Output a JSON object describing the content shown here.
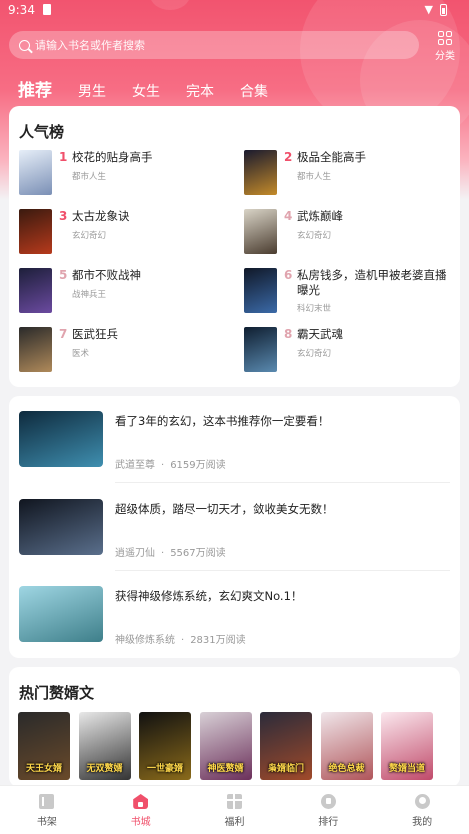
{
  "status": {
    "time": "9:34"
  },
  "search": {
    "placeholder": "请输入书名或作者搜索"
  },
  "category": {
    "label": "分类"
  },
  "tabs": [
    "推荐",
    "男生",
    "女生",
    "完本",
    "合集"
  ],
  "ranking": {
    "title": "人气榜",
    "items": [
      {
        "num": "1",
        "title": "校花的贴身高手",
        "genre": "都市人生",
        "colors": [
          "#e6eef8",
          "#7a8fb5"
        ]
      },
      {
        "num": "2",
        "title": "极品全能高手",
        "genre": "都市人生",
        "colors": [
          "#1a1a2e",
          "#c48b2a"
        ]
      },
      {
        "num": "3",
        "title": "太古龙象诀",
        "genre": "玄幻奇幻",
        "colors": [
          "#3a1a0f",
          "#b73a1c"
        ]
      },
      {
        "num": "4",
        "title": "武炼巅峰",
        "genre": "玄幻奇幻",
        "colors": [
          "#d9d4c7",
          "#4a3c2f"
        ]
      },
      {
        "num": "5",
        "title": "都市不败战神",
        "genre": "战神兵王",
        "colors": [
          "#1d1f3a",
          "#6b4aa0"
        ]
      },
      {
        "num": "6",
        "title": "私房钱多，造机甲被老婆直播曝光",
        "genre": "科幻末世",
        "colors": [
          "#101828",
          "#3b6aa8"
        ]
      },
      {
        "num": "7",
        "title": "医武狂兵",
        "genre": "医术",
        "colors": [
          "#2a2a2a",
          "#b08a5a"
        ]
      },
      {
        "num": "8",
        "title": "霸天武魂",
        "genre": "玄幻奇幻",
        "colors": [
          "#0f1e30",
          "#5a8ab0"
        ]
      }
    ]
  },
  "recommendations": [
    {
      "headline": "看了3年的玄幻，这本书推荐你一定要看！",
      "book": "武道至尊",
      "reads": "6159万阅读",
      "colors": [
        "#0e2a3d",
        "#3f8fb0"
      ]
    },
    {
      "headline": "超级体质，踏尽一切天才，敛收美女无数！",
      "book": "逍遥刀仙",
      "reads": "5567万阅读",
      "colors": [
        "#10151f",
        "#5a6f8c"
      ]
    },
    {
      "headline": "获得神级修炼系统，玄幻爽文No.1！",
      "book": "神级修炼系统",
      "reads": "2831万阅读",
      "colors": [
        "#9fd6e3",
        "#3e7f8a"
      ]
    }
  ],
  "hot": {
    "title": "热门赘婿文",
    "covers": [
      {
        "text": "天王女婿",
        "colors": [
          "#2a2a2a",
          "#6a4a2a"
        ]
      },
      {
        "text": "无双赘婿",
        "colors": [
          "#e8e8e8",
          "#333333"
        ]
      },
      {
        "text": "一世豪婿",
        "colors": [
          "#111111",
          "#8a6a1a"
        ]
      },
      {
        "text": "神医赘婿",
        "colors": [
          "#d8d0d6",
          "#6b2f5a"
        ]
      },
      {
        "text": "枭婿临门",
        "colors": [
          "#2b2b3a",
          "#a04a2a"
        ]
      },
      {
        "text": "绝色总裁",
        "colors": [
          "#f0e6ea",
          "#b0555a"
        ]
      },
      {
        "text": "赘婿当道",
        "colors": [
          "#fbe8ee",
          "#c04a6a"
        ]
      }
    ]
  },
  "tabbar": [
    {
      "label": "书架",
      "icon": "bookshelf-icon"
    },
    {
      "label": "书城",
      "icon": "bookstore-icon"
    },
    {
      "label": "福利",
      "icon": "gift-icon"
    },
    {
      "label": "排行",
      "icon": "ranking-icon"
    },
    {
      "label": "我的",
      "icon": "profile-icon"
    }
  ],
  "accent": "#f0506b"
}
